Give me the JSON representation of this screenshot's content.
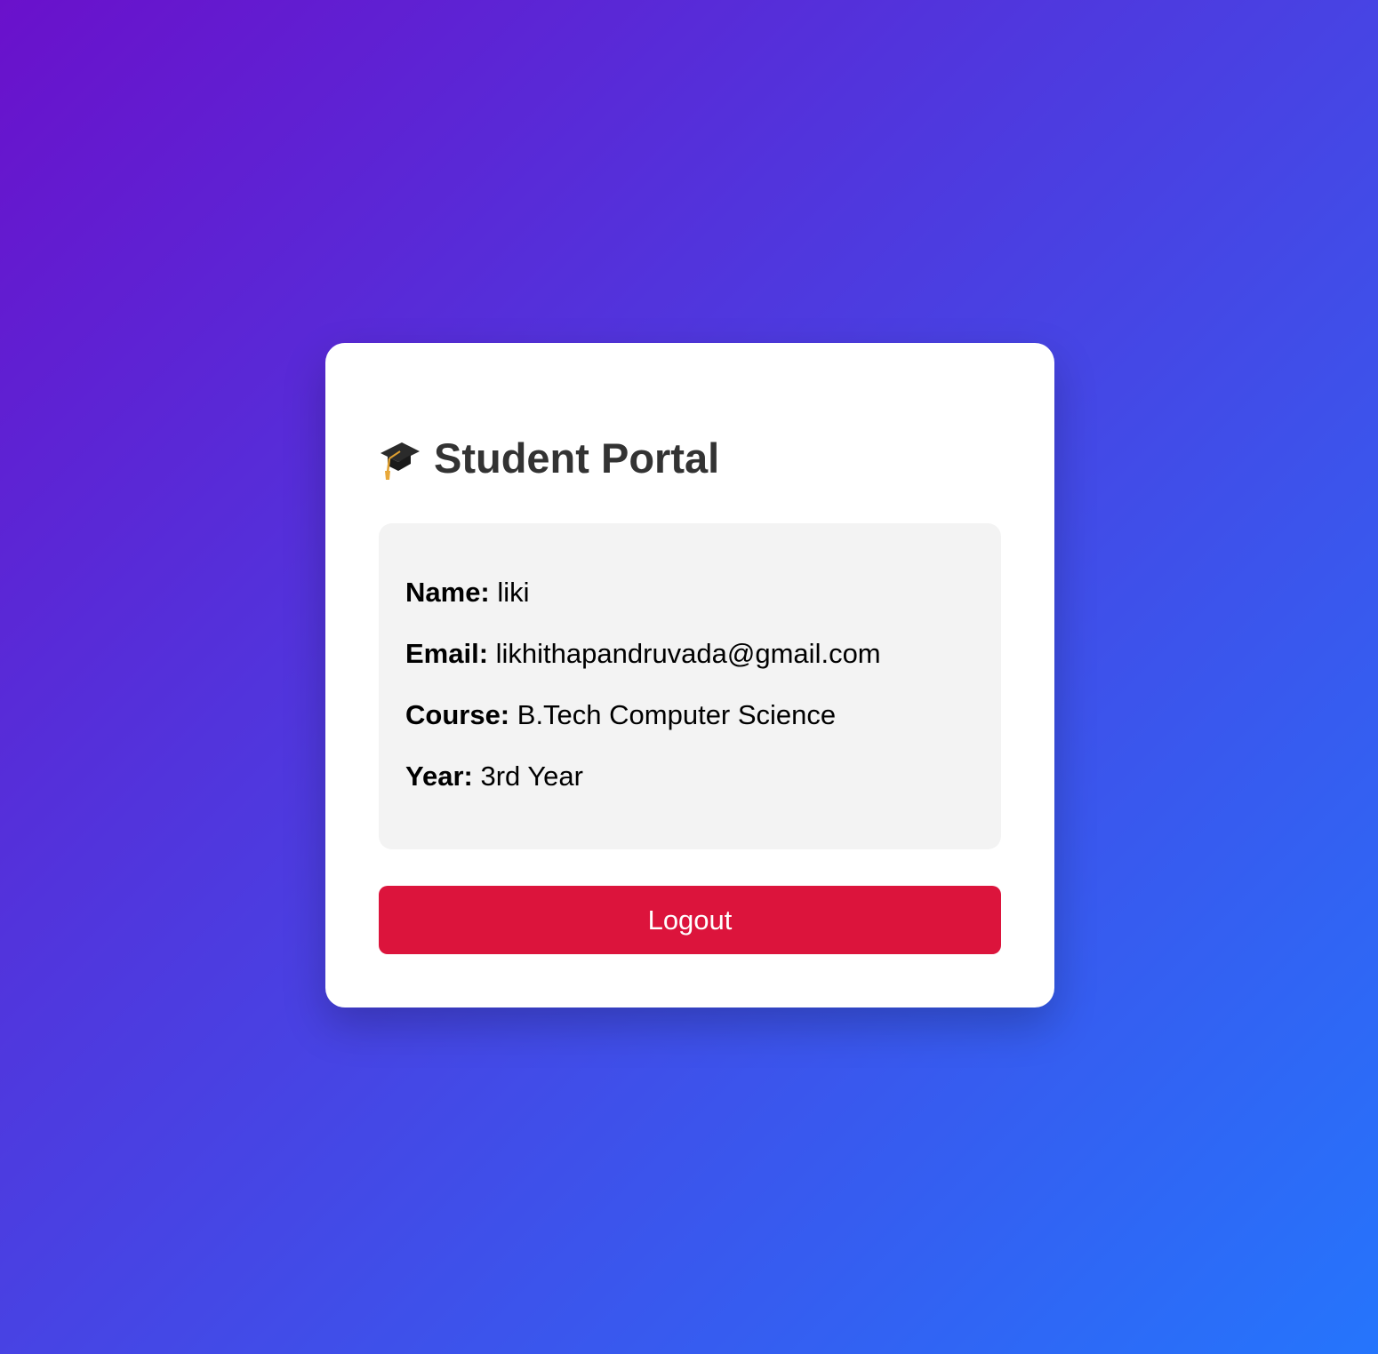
{
  "header": {
    "title": "Student Portal",
    "icon": "graduation-cap-icon"
  },
  "profile": {
    "name_label": "Name:",
    "name_value": "liki",
    "email_label": "Email:",
    "email_value": "likhithapandruvada@gmail.com",
    "course_label": "Course:",
    "course_value": "B.Tech Computer Science",
    "year_label": "Year:",
    "year_value": "3rd Year"
  },
  "actions": {
    "logout_label": "Logout"
  },
  "colors": {
    "gradient_start": "#6a11cb",
    "gradient_end": "#2575fc",
    "card_bg": "#ffffff",
    "info_bg": "#f3f3f3",
    "logout_bg": "#dc143c",
    "title_color": "#333333"
  }
}
